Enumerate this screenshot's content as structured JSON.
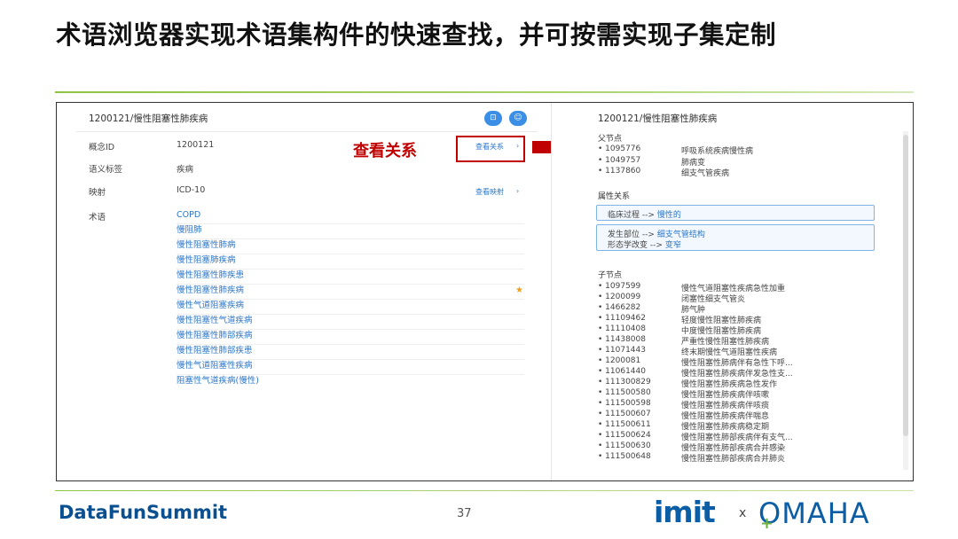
{
  "slide": {
    "title": "术语浏览器实现术语集构件的快速查找，并可按需实现子集定制",
    "footer_brand": "DataFunSummit",
    "page_number": "37",
    "logo_left": "imit",
    "logo_x": "x",
    "logo_right": "OMAHA"
  },
  "annotation": {
    "text": "查看关系"
  },
  "left_panel": {
    "title": "1200121/慢性阻塞性肺疾病",
    "fields": [
      {
        "label": "概念ID",
        "value": "1200121"
      },
      {
        "label": "语义标签",
        "value": "疾病"
      },
      {
        "label": "映射",
        "value": "ICD-10"
      },
      {
        "label": "术语",
        "value": ""
      }
    ],
    "view_relations_link": "查看关系",
    "view_mapping_link": "查看映射",
    "terms": [
      "COPD",
      "慢阻肺",
      "慢性阻塞性肺病",
      "慢性阻塞肺疾病",
      "慢性阻塞性肺疾患",
      "慢性阻塞性肺疾病",
      "慢性气道阻塞疾病",
      "慢性阻塞性气道疾病",
      "慢性阻塞性肺部疾病",
      "慢性阻塞性肺部疾患",
      "慢性气道阻塞性疾病",
      "阻塞性气道疾病(慢性)"
    ]
  },
  "right_panel": {
    "title": "1200121/慢性阻塞性肺疾病",
    "parents_heading": "父节点",
    "parents": [
      {
        "id": "1095776",
        "name": "呼吸系统疾病慢性病"
      },
      {
        "id": "1049757",
        "name": "肺病变"
      },
      {
        "id": "1137860",
        "name": "细支气管疾病"
      }
    ],
    "attributes_heading": "属性关系",
    "attr_box1": [
      {
        "attr": "临床过程",
        "arrow": "-->",
        "target": "慢性的"
      }
    ],
    "attr_box2": [
      {
        "attr": "发生部位",
        "arrow": "-->",
        "target": "细支气管结构"
      },
      {
        "attr": "形态学改变",
        "arrow": "-->",
        "target": "变窄"
      }
    ],
    "children_heading": "子节点",
    "children": [
      {
        "id": "1097599",
        "name": "慢性气道阻塞性疾病急性加重"
      },
      {
        "id": "1200099",
        "name": "闭塞性细支气管炎"
      },
      {
        "id": "1466282",
        "name": "肺气肿"
      },
      {
        "id": "11109462",
        "name": "轻度慢性阻塞性肺疾病"
      },
      {
        "id": "11110408",
        "name": "中度慢性阻塞性肺疾病"
      },
      {
        "id": "11438008",
        "name": "严重性慢性阻塞性肺疾病"
      },
      {
        "id": "11071443",
        "name": "终末期慢性气道阻塞性疾病"
      },
      {
        "id": "1200081",
        "name": "慢性阻塞性肺病伴有急性下呼..."
      },
      {
        "id": "11061440",
        "name": "慢性阻塞性肺疾病伴发急性支..."
      },
      {
        "id": "111300829",
        "name": "慢性阻塞性肺疾病急性发作"
      },
      {
        "id": "111500580",
        "name": "慢性阻塞性肺疾病伴咳嗽"
      },
      {
        "id": "111500598",
        "name": "慢性阻塞性肺疾病伴咳痰"
      },
      {
        "id": "111500607",
        "name": "慢性阻塞性肺疾病伴喘息"
      },
      {
        "id": "111500611",
        "name": "慢性阻塞性肺疾病稳定期"
      },
      {
        "id": "111500624",
        "name": "慢性阻塞性肺部疾病伴有支气..."
      },
      {
        "id": "111500630",
        "name": "慢性阻塞性肺部疾病合并感染"
      },
      {
        "id": "111500648",
        "name": "慢性阻塞性肺部疾病合并肺炎"
      }
    ]
  }
}
